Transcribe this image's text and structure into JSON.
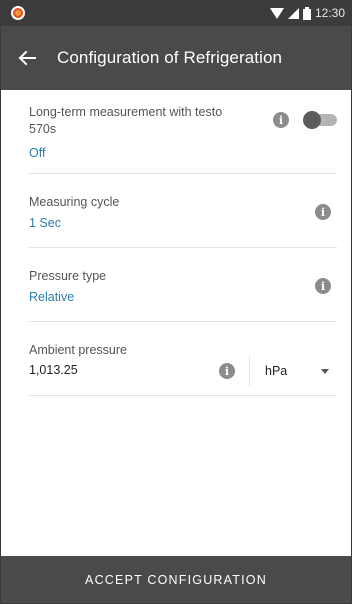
{
  "status_bar": {
    "time": "12:30",
    "icons": [
      "app-notification-icon",
      "wifi-icon",
      "signal-icon",
      "battery-icon"
    ]
  },
  "app_bar": {
    "back_icon": "arrow-left-icon",
    "title": "Configuration of Refrigeration"
  },
  "settings": {
    "long_term": {
      "label": "Long-term measurement with testo 570s",
      "value": "Off",
      "toggle_on": false
    },
    "measuring_cycle": {
      "label": "Measuring cycle",
      "value": "1 Sec"
    },
    "pressure_type": {
      "label": "Pressure type",
      "value": "Relative"
    },
    "ambient_pressure": {
      "label": "Ambient pressure",
      "value": "1,013.25",
      "unit": "hPa"
    }
  },
  "footer": {
    "accept_label": "ACCEPT CONFIGURATION"
  },
  "colors": {
    "app_bar": "#4a4a4a",
    "status_bar": "#3c3c3c",
    "value_text": "#2a7fa8",
    "info_icon": "#8c8c8c"
  }
}
